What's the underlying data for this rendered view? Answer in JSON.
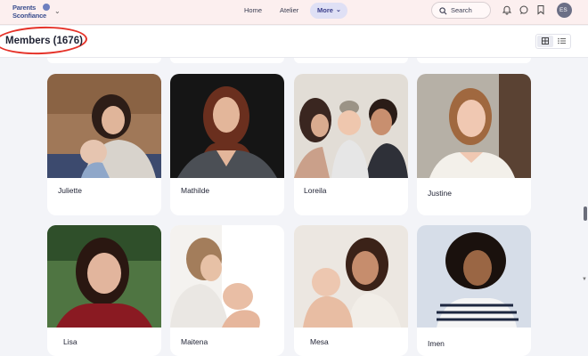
{
  "nav": {
    "logo_line1": "Parents",
    "logo_line2": "Sconfiance",
    "home": "Home",
    "atelier": "Atelier",
    "more": "More",
    "search": "Search",
    "avatar_initials": "ES"
  },
  "header": {
    "title": "Members (1676)"
  },
  "members": [
    {
      "name": "Juliette",
      "photo": "mother-with-baby-photo"
    },
    {
      "name": "Mathilde",
      "photo": "woman-portrait-photo"
    },
    {
      "name": "Loreila",
      "photo": "family-kiss-photo"
    },
    {
      "name": "Justine",
      "photo": "woman-smiling-photo"
    },
    {
      "name": "Lisa",
      "photo": "woman-smiling-photo"
    },
    {
      "name": "Maitena",
      "photo": "mother-newborn-photo"
    },
    {
      "name": "Mesa",
      "photo": "mother-with-baby-photo"
    },
    {
      "name": "Imen",
      "photo": "woman-curly-hair-photo"
    }
  ],
  "icons": {
    "search": "search-icon",
    "bell": "bell-icon",
    "chat": "chat-icon",
    "bookmark": "bookmark-icon",
    "grid": "grid-view-icon",
    "list": "list-view-icon"
  }
}
